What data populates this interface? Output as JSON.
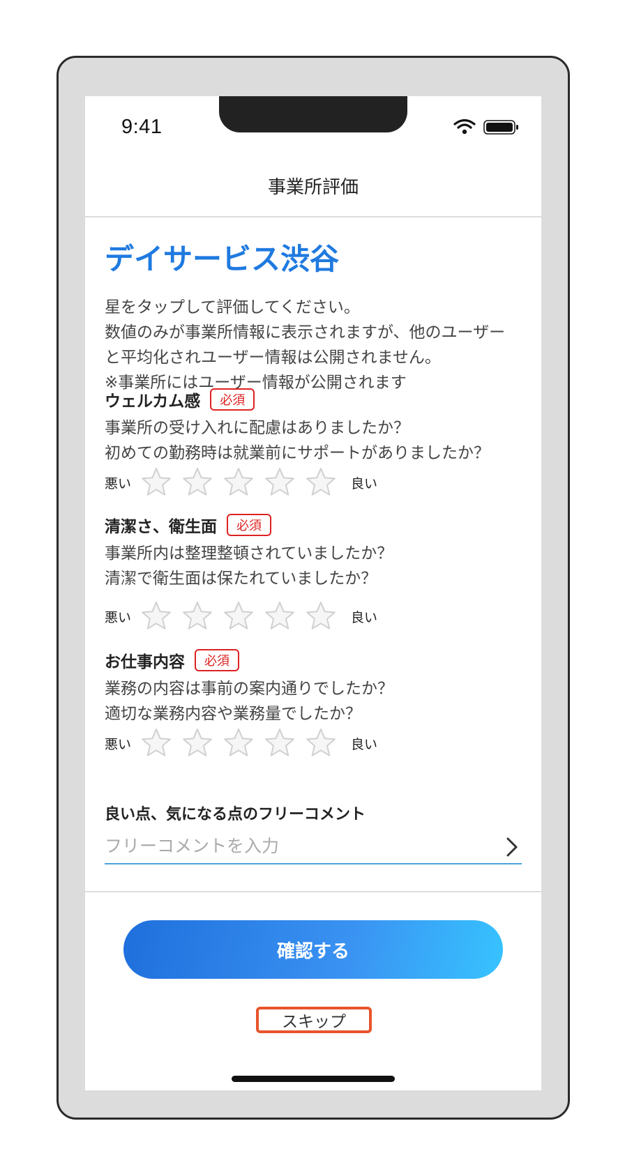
{
  "status_bar": {
    "time": "9:41"
  },
  "header": {
    "title": "事業所評価"
  },
  "facility": {
    "name": "デイサービス渋谷"
  },
  "intro": {
    "lines": [
      "星をタップして評価してください。",
      "数値のみが事業所情報に表示されますが、他のユーザー",
      "と平均化されユーザー情報は公開されません。",
      "※事業所にはユーザー情報が公開されます"
    ]
  },
  "rating_scale": {
    "low": "悪い",
    "high": "良い",
    "max_stars": 5
  },
  "sections": [
    {
      "title": "ウェルカム感",
      "badge": "必須",
      "questions": [
        "事業所の受け入れに配慮はありましたか？",
        "初めての勤務時は就業前にサポートがありましたか？"
      ],
      "rating": 0
    },
    {
      "title": "清潔さ、衛生面",
      "badge": "必須",
      "questions": [
        "事業所内は整理整頓されていましたか？",
        "清潔で衛生面は保たれていましたか？"
      ],
      "rating": 0
    },
    {
      "title": "お仕事内容",
      "badge": "必須",
      "questions": [
        "業務の内容は事前の案内通りでしたか？",
        "適切な業務内容や業務量でしたか？"
      ],
      "rating": 0
    }
  ],
  "comment": {
    "label": "良い点、気になる点のフリーコメント",
    "placeholder": "フリーコメントを入力",
    "value": ""
  },
  "actions": {
    "confirm_label": "確認する",
    "skip_label": "スキップ"
  },
  "colors": {
    "accent": "#1f7ae0",
    "required": "#dd2222",
    "highlight": "#e8542c",
    "star_empty": "#d0d0d0"
  }
}
